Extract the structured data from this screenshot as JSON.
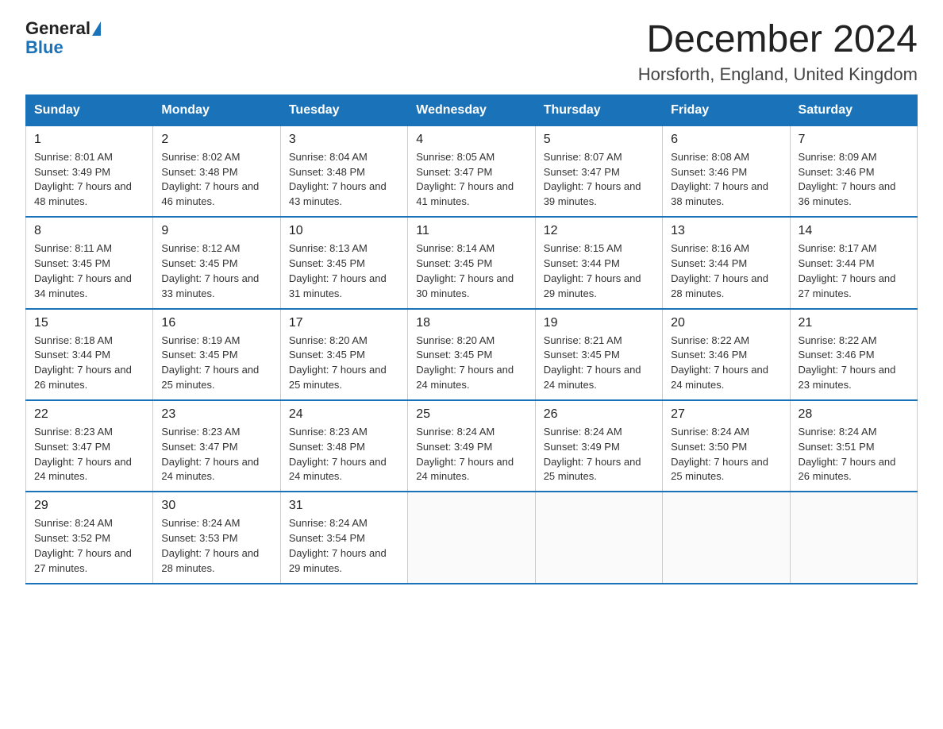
{
  "header": {
    "logo": {
      "general": "General",
      "blue": "Blue"
    },
    "month_year": "December 2024",
    "location": "Horsforth, England, United Kingdom"
  },
  "days_of_week": [
    "Sunday",
    "Monday",
    "Tuesday",
    "Wednesday",
    "Thursday",
    "Friday",
    "Saturday"
  ],
  "weeks": [
    [
      {
        "day": "1",
        "sunrise": "8:01 AM",
        "sunset": "3:49 PM",
        "daylight": "7 hours and 48 minutes."
      },
      {
        "day": "2",
        "sunrise": "8:02 AM",
        "sunset": "3:48 PM",
        "daylight": "7 hours and 46 minutes."
      },
      {
        "day": "3",
        "sunrise": "8:04 AM",
        "sunset": "3:48 PM",
        "daylight": "7 hours and 43 minutes."
      },
      {
        "day": "4",
        "sunrise": "8:05 AM",
        "sunset": "3:47 PM",
        "daylight": "7 hours and 41 minutes."
      },
      {
        "day": "5",
        "sunrise": "8:07 AM",
        "sunset": "3:47 PM",
        "daylight": "7 hours and 39 minutes."
      },
      {
        "day": "6",
        "sunrise": "8:08 AM",
        "sunset": "3:46 PM",
        "daylight": "7 hours and 38 minutes."
      },
      {
        "day": "7",
        "sunrise": "8:09 AM",
        "sunset": "3:46 PM",
        "daylight": "7 hours and 36 minutes."
      }
    ],
    [
      {
        "day": "8",
        "sunrise": "8:11 AM",
        "sunset": "3:45 PM",
        "daylight": "7 hours and 34 minutes."
      },
      {
        "day": "9",
        "sunrise": "8:12 AM",
        "sunset": "3:45 PM",
        "daylight": "7 hours and 33 minutes."
      },
      {
        "day": "10",
        "sunrise": "8:13 AM",
        "sunset": "3:45 PM",
        "daylight": "7 hours and 31 minutes."
      },
      {
        "day": "11",
        "sunrise": "8:14 AM",
        "sunset": "3:45 PM",
        "daylight": "7 hours and 30 minutes."
      },
      {
        "day": "12",
        "sunrise": "8:15 AM",
        "sunset": "3:44 PM",
        "daylight": "7 hours and 29 minutes."
      },
      {
        "day": "13",
        "sunrise": "8:16 AM",
        "sunset": "3:44 PM",
        "daylight": "7 hours and 28 minutes."
      },
      {
        "day": "14",
        "sunrise": "8:17 AM",
        "sunset": "3:44 PM",
        "daylight": "7 hours and 27 minutes."
      }
    ],
    [
      {
        "day": "15",
        "sunrise": "8:18 AM",
        "sunset": "3:44 PM",
        "daylight": "7 hours and 26 minutes."
      },
      {
        "day": "16",
        "sunrise": "8:19 AM",
        "sunset": "3:45 PM",
        "daylight": "7 hours and 25 minutes."
      },
      {
        "day": "17",
        "sunrise": "8:20 AM",
        "sunset": "3:45 PM",
        "daylight": "7 hours and 25 minutes."
      },
      {
        "day": "18",
        "sunrise": "8:20 AM",
        "sunset": "3:45 PM",
        "daylight": "7 hours and 24 minutes."
      },
      {
        "day": "19",
        "sunrise": "8:21 AM",
        "sunset": "3:45 PM",
        "daylight": "7 hours and 24 minutes."
      },
      {
        "day": "20",
        "sunrise": "8:22 AM",
        "sunset": "3:46 PM",
        "daylight": "7 hours and 24 minutes."
      },
      {
        "day": "21",
        "sunrise": "8:22 AM",
        "sunset": "3:46 PM",
        "daylight": "7 hours and 23 minutes."
      }
    ],
    [
      {
        "day": "22",
        "sunrise": "8:23 AM",
        "sunset": "3:47 PM",
        "daylight": "7 hours and 24 minutes."
      },
      {
        "day": "23",
        "sunrise": "8:23 AM",
        "sunset": "3:47 PM",
        "daylight": "7 hours and 24 minutes."
      },
      {
        "day": "24",
        "sunrise": "8:23 AM",
        "sunset": "3:48 PM",
        "daylight": "7 hours and 24 minutes."
      },
      {
        "day": "25",
        "sunrise": "8:24 AM",
        "sunset": "3:49 PM",
        "daylight": "7 hours and 24 minutes."
      },
      {
        "day": "26",
        "sunrise": "8:24 AM",
        "sunset": "3:49 PM",
        "daylight": "7 hours and 25 minutes."
      },
      {
        "day": "27",
        "sunrise": "8:24 AM",
        "sunset": "3:50 PM",
        "daylight": "7 hours and 25 minutes."
      },
      {
        "day": "28",
        "sunrise": "8:24 AM",
        "sunset": "3:51 PM",
        "daylight": "7 hours and 26 minutes."
      }
    ],
    [
      {
        "day": "29",
        "sunrise": "8:24 AM",
        "sunset": "3:52 PM",
        "daylight": "7 hours and 27 minutes."
      },
      {
        "day": "30",
        "sunrise": "8:24 AM",
        "sunset": "3:53 PM",
        "daylight": "7 hours and 28 minutes."
      },
      {
        "day": "31",
        "sunrise": "8:24 AM",
        "sunset": "3:54 PM",
        "daylight": "7 hours and 29 minutes."
      },
      null,
      null,
      null,
      null
    ]
  ]
}
